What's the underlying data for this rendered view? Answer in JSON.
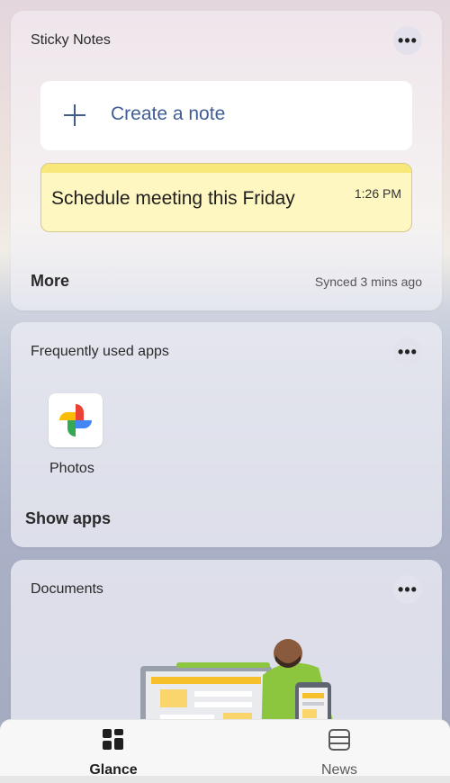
{
  "sticky_notes": {
    "title": "Sticky Notes",
    "create_label": "Create a note",
    "note": {
      "text": "Schedule meeting this Friday",
      "time": "1:26 PM"
    },
    "more_label": "More",
    "synced": "Synced 3 mins ago"
  },
  "frequent_apps": {
    "title": "Frequently used apps",
    "apps": [
      {
        "label": "Photos",
        "icon": "photos-pinwheel-icon"
      }
    ],
    "show_apps_label": "Show apps"
  },
  "documents": {
    "title": "Documents"
  },
  "menu_glyph": "•••",
  "bottom_nav": {
    "items": [
      {
        "label": "Glance",
        "icon": "glance-grid-icon",
        "active": true
      },
      {
        "label": "News",
        "icon": "news-icon",
        "active": false
      }
    ]
  },
  "colors": {
    "accent_blue": "#3f5e96",
    "note_yellow": "#fff7c2",
    "note_bar": "#f8e879"
  }
}
